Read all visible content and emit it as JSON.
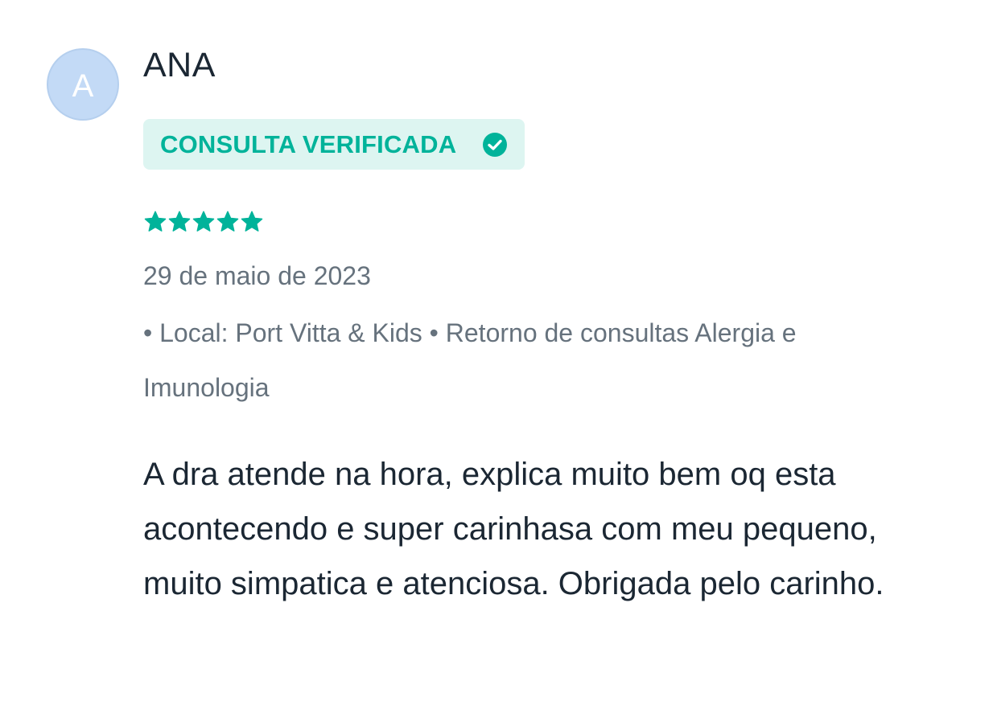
{
  "review": {
    "avatar_initial": "A",
    "author": "ANA",
    "badge": {
      "label": "CONSULTA VERIFICADA",
      "icon": "check-circle-icon"
    },
    "rating": {
      "value": 5,
      "max": 5,
      "icon": "star-icon"
    },
    "date": "29 de maio de 2023",
    "meta": "• Local: Port Vitta & Kids • Retorno de consultas Alergia e Imunologia",
    "text": "A dra atende na hora, explica muito bem oq esta acontecendo e super carinhasa com meu pequeno, muito simpatica e atenciosa. Obrigada pelo carinho."
  },
  "colors": {
    "accent": "#00b39a",
    "badge_bg": "#ddf5f1",
    "avatar_bg": "#c3daf6",
    "text_primary": "#1b2733",
    "text_secondary": "#66727d"
  }
}
